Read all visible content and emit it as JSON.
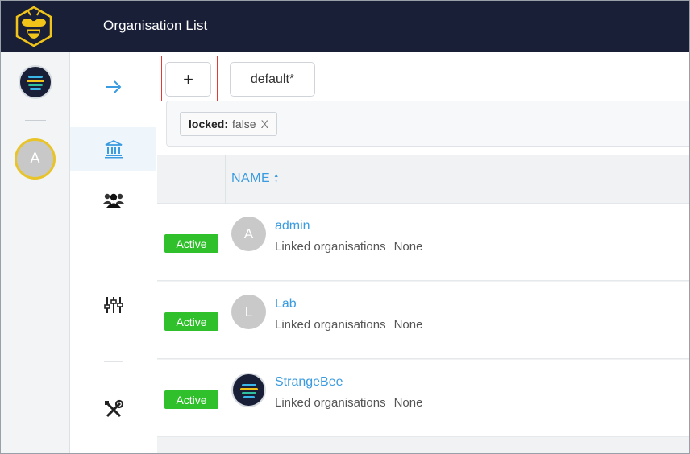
{
  "header": {
    "title": "Organisation List"
  },
  "rail": {
    "user_initial": "A"
  },
  "toolbar": {
    "add_label": "+",
    "view_label": "default*"
  },
  "filter": {
    "key": "locked:",
    "value": "false",
    "remove_label": "X"
  },
  "table": {
    "column_name": "NAME"
  },
  "rows": [
    {
      "status": "Active",
      "initial": "A",
      "name": "admin",
      "linked_label": "Linked organisations",
      "linked_value": "None"
    },
    {
      "status": "Active",
      "initial": "L",
      "name": "Lab",
      "linked_label": "Linked organisations",
      "linked_value": "None"
    },
    {
      "status": "Active",
      "initial": "",
      "name": "StrangeBee",
      "linked_label": "Linked organisations",
      "linked_value": "None"
    }
  ],
  "icons": {
    "logo": "bee-logo-icon",
    "nav": [
      "arrow-right-icon",
      "bank-icon",
      "users-icon",
      "sliders-icon",
      "tools-icon"
    ]
  },
  "colors": {
    "topbar": "#1a1f38",
    "accent": "#3a9be0",
    "status": "#2fc02b",
    "highlight": "#e53935"
  }
}
